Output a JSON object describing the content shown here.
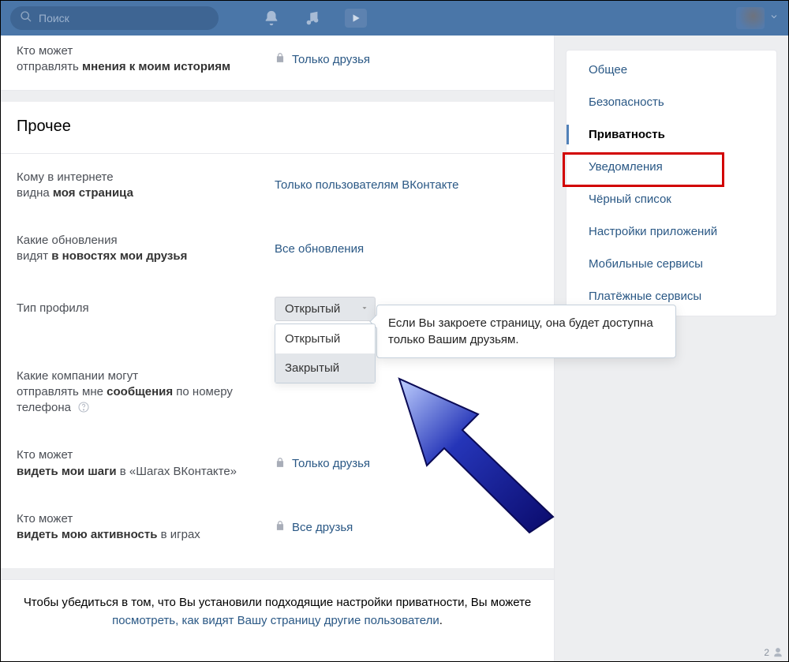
{
  "header": {
    "search_placeholder": "Поиск"
  },
  "stories_row": {
    "label_line1": "Кто может",
    "label_line2_plain": "отправлять ",
    "label_line2_bold": "мнения к моим историям",
    "value": "Только друзья"
  },
  "section_title": "Прочее",
  "rows": {
    "page_visibility": {
      "label_line1": "Кому в интернете",
      "label_line2_plain": "видна ",
      "label_line2_bold": "моя страница",
      "value": "Только пользователям ВКонтакте"
    },
    "news_updates": {
      "label_line1": "Какие обновления",
      "label_line2_plain": "видят ",
      "label_line2_bold": "в новостях мои друзья",
      "value": "Все обновления"
    },
    "profile_type": {
      "label": "Тип профиля",
      "selected": "Открытый",
      "options": [
        "Открытый",
        "Закрытый"
      ],
      "tooltip": "Если Вы закроете страницу, она будет доступна только Вашим друзьям."
    },
    "company_messages": {
      "label_line1": "Какие компании могут",
      "label_line2_plain1": "отправлять мне ",
      "label_line2_bold": "сообщения",
      "label_line2_plain2": " по номеру телефона"
    },
    "steps": {
      "label_line1": "Кто может",
      "label_line2_bold": "видеть мои шаги",
      "label_line2_plain": " в «Шагах ВКонтакте»",
      "value": "Только друзья"
    },
    "game_activity": {
      "label_line1": "Кто может",
      "label_line2_bold": "видеть мою активность",
      "label_line2_plain": " в играх",
      "value": "Все друзья"
    }
  },
  "footer": {
    "text_before": "Чтобы убедиться в том, что Вы установили подходящие настройки приватности, Вы можете ",
    "link": "посмотреть, как видят Вашу страницу другие пользователи",
    "text_after": "."
  },
  "sidebar": {
    "items": [
      "Общее",
      "Безопасность",
      "Приватность",
      "Уведомления",
      "Чёрный список",
      "Настройки приложений",
      "Мобильные сервисы",
      "Платёжные сервисы"
    ],
    "active_index": 2
  },
  "corner_count": "2"
}
